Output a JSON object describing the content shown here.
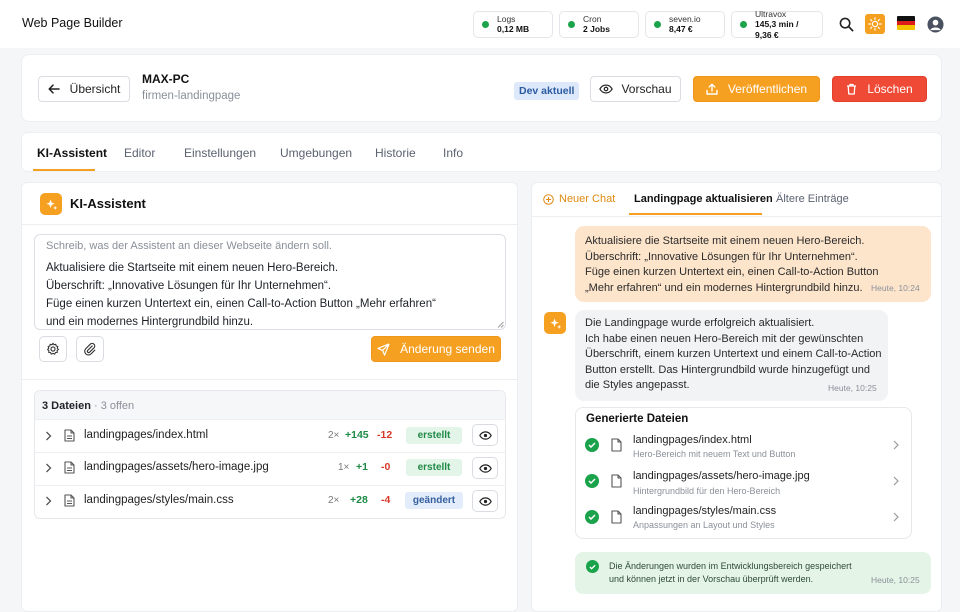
{
  "app": {
    "title": "Web Page Builder"
  },
  "stats": [
    {
      "label": "Logs",
      "value": "0,12 MB"
    },
    {
      "label": "Cron",
      "value": "2 Jobs"
    },
    {
      "label": "seven.io",
      "value": "8,47 €"
    },
    {
      "label": "Ultravox",
      "value": "145,3 min / 9,36 €"
    }
  ],
  "header": {
    "back_label": "Übersicht",
    "site_name": "MAX-PC",
    "site_slug": "firmen-landingpage",
    "dev_badge": "Dev aktuell",
    "preview_label": "Vorschau",
    "publish_label": "Veröffentlichen",
    "delete_label": "Löschen"
  },
  "tabs": [
    "KI-Assistent",
    "Editor",
    "Einstellungen",
    "Umgebungen",
    "Historie",
    "Info"
  ],
  "assistant": {
    "title": "KI-Assistent",
    "placeholder": "Schreib, was der Assistent an dieser Webseite ändern soll.",
    "prompt": "Aktualisiere die Startseite mit einem neuen Hero-Bereich.\nÜberschrift: „Innovative Lösungen für Ihr Unternehmen“.\nFüge einen kurzen Untertext ein, einen Call-to-Action Button „Mehr erfahren“\nund ein modernes Hintergrundbild hinzu.",
    "send_label": "Änderung senden"
  },
  "files": {
    "count_label": "3 Dateien",
    "open_label": "· 3 offen",
    "rows": [
      {
        "name": "landingpages/index.html",
        "times": "2×",
        "added": "+145",
        "removed": "-12",
        "status": "erstellt"
      },
      {
        "name": "landingpages/assets/hero-image.jpg",
        "times": "1×",
        "added": "+1",
        "removed": "-0",
        "status": "erstellt"
      },
      {
        "name": "landingpages/styles/main.css",
        "times": "2×",
        "added": "+28",
        "removed": "-4",
        "status": "geändert"
      }
    ]
  },
  "chat": {
    "new_chat": "Neuer Chat",
    "active_tab": "Landingpage aktualisieren",
    "older_tab": "Ältere Einträge",
    "user_message": "Aktualisiere die Startseite mit einem neuen Hero-Bereich.\nÜberschrift: „Innovative Lösungen für Ihr Unternehmen“.\nFüge einen kurzen Untertext ein, einen Call-to-Action Button\n„Mehr erfahren“ und ein modernes Hintergrundbild hinzu.",
    "user_time": "Heute, 10:24",
    "bot_message": "Die Landingpage wurde erfolgreich aktualisiert.\nIch habe einen neuen Hero-Bereich mit der gewünschten\nÜberschrift, einem kurzen Untertext und einem Call-to-Action\nButton erstellt. Das Hintergrundbild wurde hinzugefügt und\ndie Styles angepasst.",
    "bot_time": "Heute, 10:25",
    "generated_title": "Generierte Dateien",
    "generated": [
      {
        "name": "landingpages/index.html",
        "desc": "Hero-Bereich mit neuem Text und Button"
      },
      {
        "name": "landingpages/assets/hero-image.jpg",
        "desc": "Hintergrundbild für den Hero-Bereich"
      },
      {
        "name": "landingpages/styles/main.css",
        "desc": "Anpassungen an Layout und Styles"
      }
    ],
    "success_message": "Die Änderungen wurden im Entwicklungsbereich gespeichert\nund können jetzt in der Vorschau überprüft werden.",
    "success_time": "Heute, 10:25"
  },
  "colors": {
    "accent": "#f6a021",
    "danger": "#ee4a36",
    "success": "#1aa34a"
  }
}
